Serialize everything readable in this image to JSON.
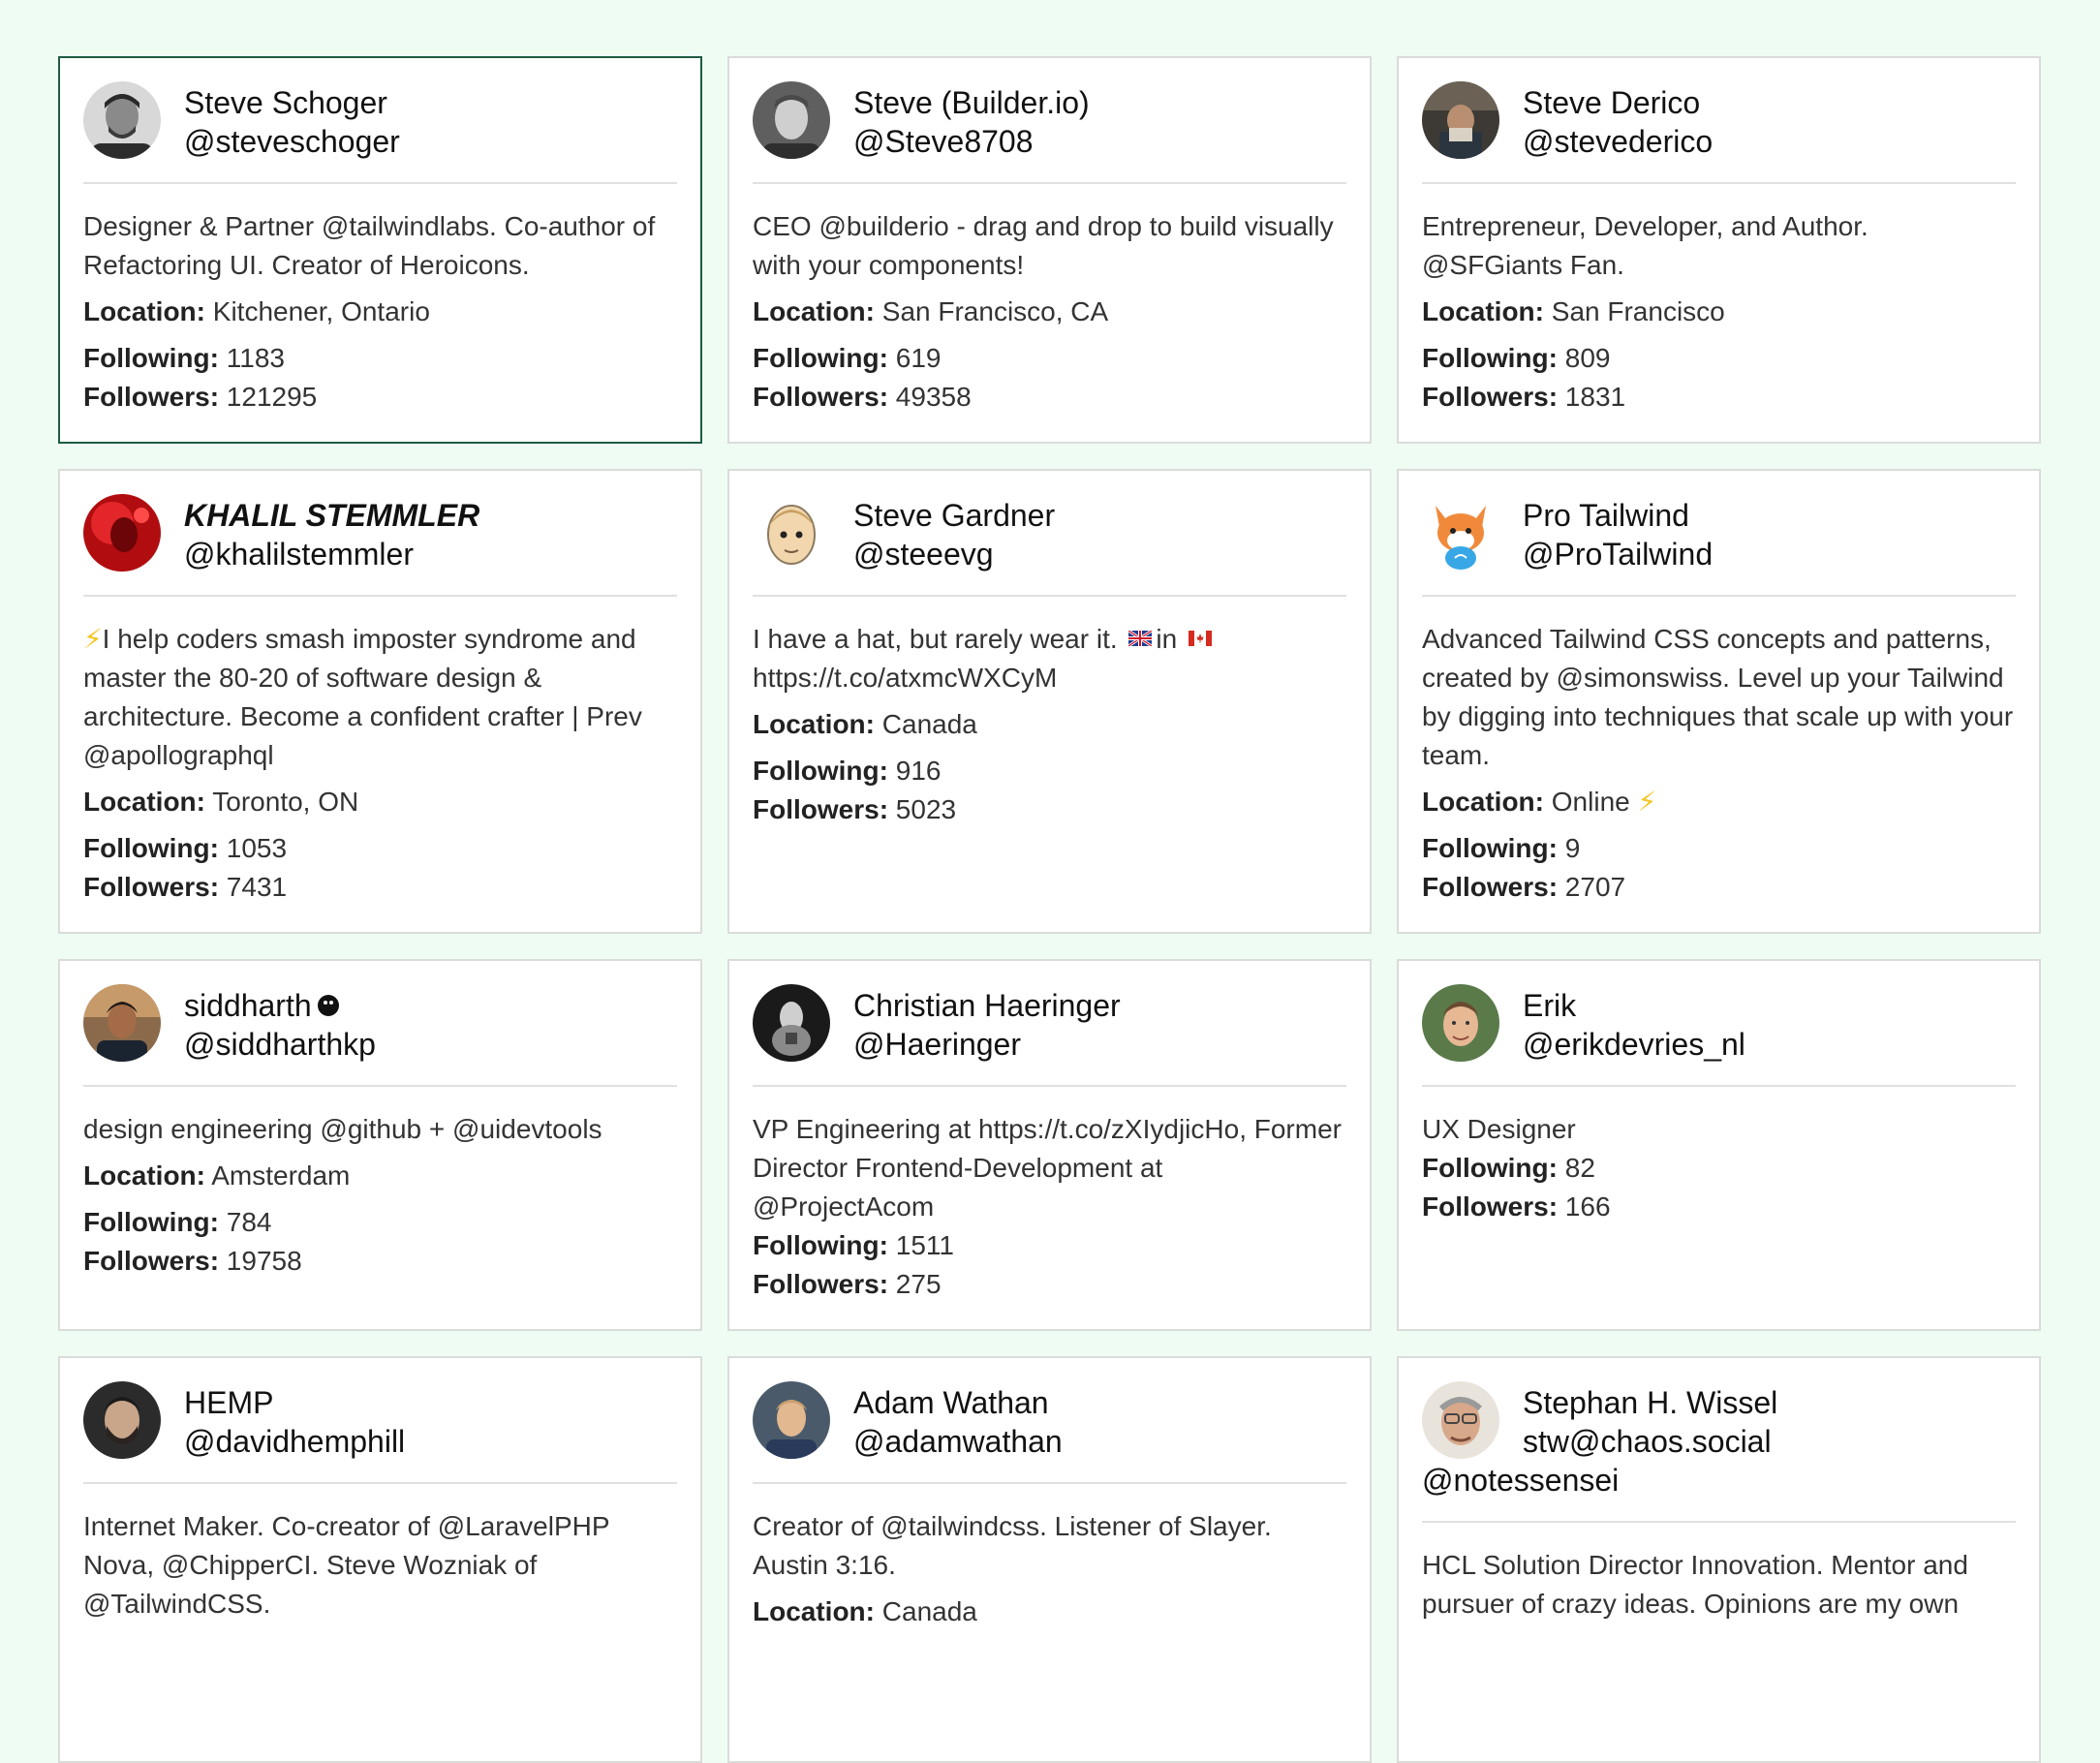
{
  "cards": [
    {
      "name": "Steve Schoger",
      "handle": "@steveschoger",
      "bio": "Designer & Partner @tailwindlabs. Co-author of Refactoring UI. Creator of Heroicons.",
      "location_label": "Location:",
      "location": "Kitchener, Ontario",
      "following_label": "Following:",
      "following": "1183",
      "followers_label": "Followers:",
      "followers": "121295"
    },
    {
      "name": "Steve (Builder.io)",
      "handle": "@Steve8708",
      "bio": "CEO @builderio - drag and drop to build visually with your components!",
      "location_label": "Location:",
      "location": "San Francisco, CA",
      "following_label": "Following:",
      "following": "619",
      "followers_label": "Followers:",
      "followers": "49358"
    },
    {
      "name": "Steve Derico",
      "handle": "@stevederico",
      "bio": "Entrepreneur, Developer, and Author. @SFGiants Fan.",
      "location_label": "Location:",
      "location": "San Francisco",
      "following_label": "Following:",
      "following": "809",
      "followers_label": "Followers:",
      "followers": "1831"
    },
    {
      "name": "KHALIL STEMMLER",
      "handle": "@khalilstemmler",
      "bio_prefix": "⚡",
      "bio": "I help coders smash imposter syndrome and master the 80-20 of software design & architecture. Become a confident crafter | Prev @apollographql",
      "location_label": "Location:",
      "location": "Toronto, ON",
      "following_label": "Following:",
      "following": "1053",
      "followers_label": "Followers:",
      "followers": "7431"
    },
    {
      "name": "Steve Gardner",
      "handle": "@steeevg",
      "bio_part1": "I have a hat, but rarely wear it.",
      "bio_part2": "in",
      "bio_part3": "https://t.co/atxmcWXCyM",
      "location_label": "Location:",
      "location": "Canada",
      "following_label": "Following:",
      "following": "916",
      "followers_label": "Followers:",
      "followers": "5023"
    },
    {
      "name": "Pro Tailwind",
      "handle": "@ProTailwind",
      "bio": "Advanced Tailwind CSS concepts and patterns, created by @simonswiss. Level up your Tailwind by digging into techniques that scale up with your team.",
      "location_label": "Location:",
      "location": "Online",
      "location_suffix": "⚡",
      "following_label": "Following:",
      "following": "9",
      "followers_label": "Followers:",
      "followers": "2707"
    },
    {
      "name": "siddharth",
      "handle": "@siddharthkp",
      "bio": "design engineering @github + @uidevtools",
      "location_label": "Location:",
      "location": "Amsterdam",
      "following_label": "Following:",
      "following": "784",
      "followers_label": "Followers:",
      "followers": "19758"
    },
    {
      "name": "Christian Haeringer",
      "handle": "@Haeringer",
      "bio": "VP Engineering at https://t.co/zXIydjicHo, Former Director Frontend-Development at @ProjectAcom",
      "following_label": "Following:",
      "following": "1511",
      "followers_label": "Followers:",
      "followers": "275"
    },
    {
      "name": "Erik",
      "handle": "@erikdevries_nl",
      "bio": "UX Designer",
      "following_label": "Following:",
      "following": "82",
      "followers_label": "Followers:",
      "followers": "166"
    },
    {
      "name": "HEMP",
      "handle": "@davidhemphill",
      "bio": "Internet Maker. Co-creator of @LaravelPHP Nova, @ChipperCI. Steve Wozniak of @TailwindCSS."
    },
    {
      "name": "Adam Wathan",
      "handle": "@adamwathan",
      "bio": "Creator of @tailwindcss. Listener of Slayer. Austin 3:16.",
      "location_label": "Location:",
      "location": "Canada"
    },
    {
      "name": "Stephan H. Wissel",
      "handle": "stw@chaos.social",
      "handle2": "@notessensei",
      "bio": "HCL Solution Director Innovation. Mentor and pursuer of crazy ideas. Opinions are my own"
    }
  ]
}
